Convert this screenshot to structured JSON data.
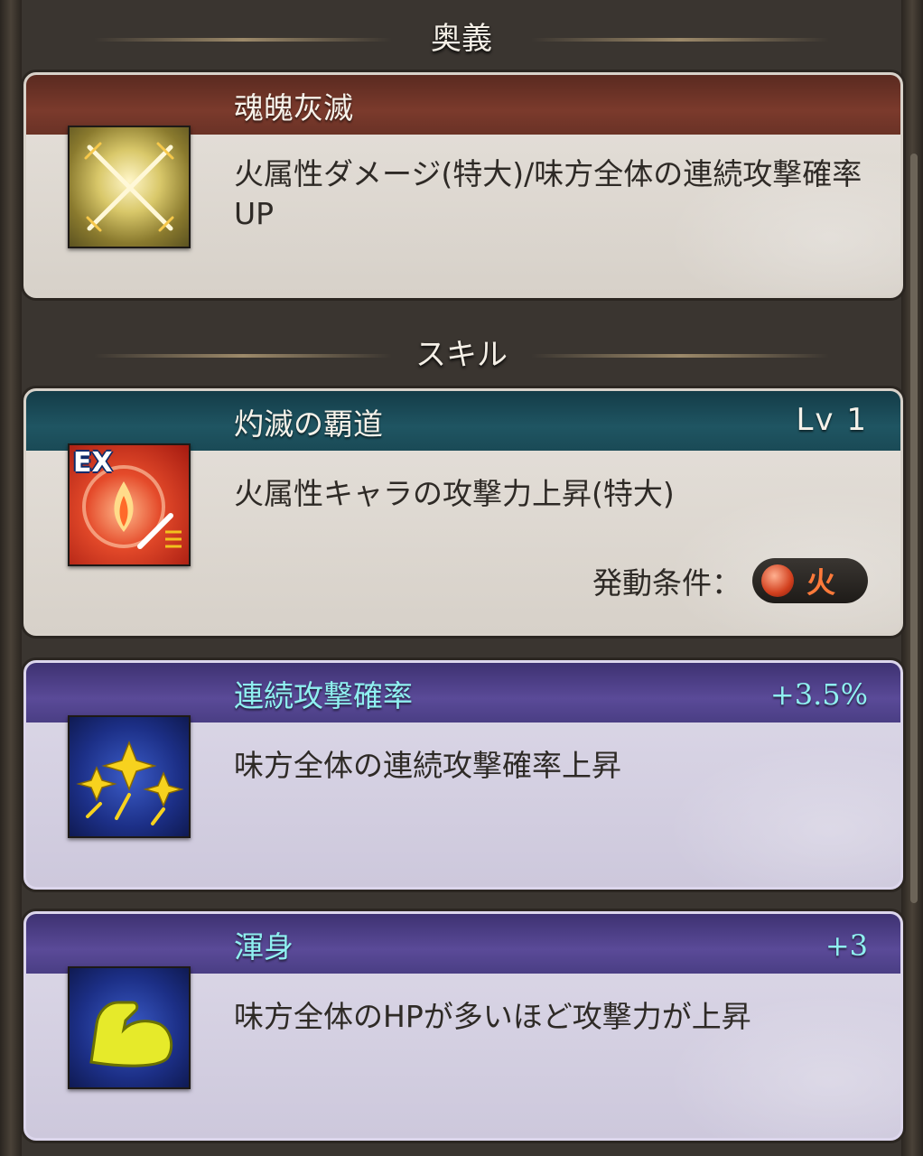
{
  "sections": {
    "ougi_header": "奥義",
    "skill_header": "スキル"
  },
  "ougi": {
    "name": "魂魄灰滅",
    "description": "火属性ダメージ(特大)/味方全体の連続攻撃確率UP",
    "icon": "crossed-swords-icon"
  },
  "skill_ex": {
    "name": "灼滅の覇道",
    "level": "Lv 1",
    "description": "火属性キャラの攻撃力上昇(特大)",
    "badge": "EX",
    "condition_label": "発動条件：",
    "condition_element": "火",
    "icon": "fire-sword-icon"
  },
  "support_1": {
    "name": "連続攻撃確率",
    "bonus": "+3.5%",
    "description": "味方全体の連続攻撃確率上昇",
    "icon": "triple-star-icon"
  },
  "support_2": {
    "name": "渾身",
    "bonus": "+3",
    "description": "味方全体のHPが多いほど攻撃力が上昇",
    "icon": "flexed-arm-icon"
  },
  "colors": {
    "ougi_bar": "#6a3226",
    "skill_bar": "#1f5562",
    "support_bar": "#4a3e84",
    "support_title": "#8ff0f0"
  }
}
